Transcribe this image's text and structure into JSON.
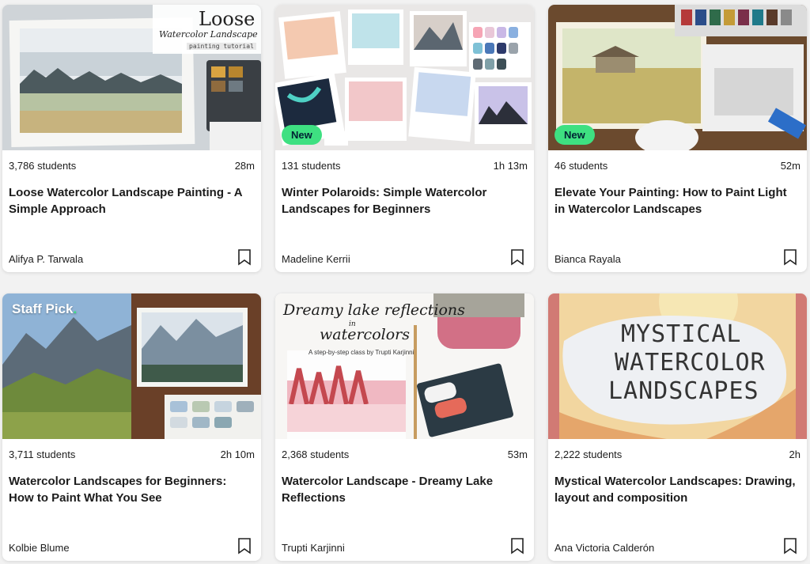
{
  "cards": [
    {
      "students": "3,786 students",
      "duration": "28m",
      "title": "Loose Watercolor Landscape Painting - A Simple Approach",
      "author": "Alifya P. Tarwala",
      "thumb_text": [
        "Loose",
        "Watercolor Landscape",
        "painting tutorial"
      ]
    },
    {
      "students": "131 students",
      "duration": "1h 13m",
      "title": "Winter Polaroids: Simple Watercolor Landscapes for Beginners",
      "author": "Madeline Kerrii",
      "badge": "New"
    },
    {
      "students": "46 students",
      "duration": "52m",
      "title": "Elevate Your Painting: How to Paint Light in Watercolor Landscapes",
      "author": "Bianca Rayala",
      "badge": "New"
    },
    {
      "students": "3,711 students",
      "duration": "2h 10m",
      "title": "Watercolor Landscapes for Beginners: How to Paint What You See",
      "author": "Kolbie Blume",
      "staff_pick": "Staff Pick",
      "staff_pick_dot": "."
    },
    {
      "students": "2,368 students",
      "duration": "53m",
      "title": "Watercolor Landscape - Dreamy Lake Reflections",
      "author": "Trupti Karjinni",
      "thumb_text": [
        "Dreamy lake reflections",
        "in",
        "watercolors",
        "A step-by-step class by Trupti Karjinni"
      ]
    },
    {
      "students": "2,222 students",
      "duration": "2h",
      "title": "Mystical Watercolor Landscapes: Drawing, layout and composition",
      "author": "Ana Victoria Calderón",
      "thumb_text": [
        "MYSTICAL",
        "WATERCOLOR",
        "LANDSCAPES"
      ]
    }
  ],
  "colors": {
    "badge_bg": "#3ee081",
    "badge_text": "#002333",
    "page_bg": "#f2f2f2"
  },
  "icons": {
    "save": "bookmark-icon"
  }
}
